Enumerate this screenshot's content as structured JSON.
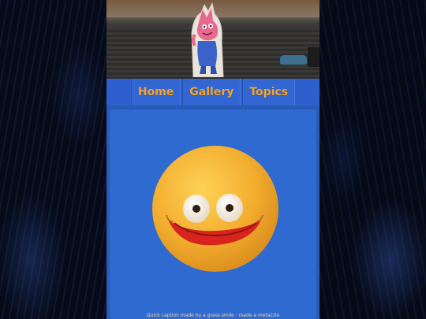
{
  "nav": {
    "items": [
      {
        "label": "Home"
      },
      {
        "label": "Gallery"
      },
      {
        "label": "Topics"
      }
    ]
  },
  "header": {
    "image": "mascot-photo"
  },
  "content": {
    "image": "smiley-face",
    "caption": "Quick caption made by a grass smile · made a metazzle"
  },
  "colors": {
    "page_bg": "#2a5bb8",
    "nav_bg": "#2d5fcf",
    "nav_text": "#f6a32d",
    "card_bg": "#2f6ad0",
    "smiley": "#f4b43a"
  }
}
